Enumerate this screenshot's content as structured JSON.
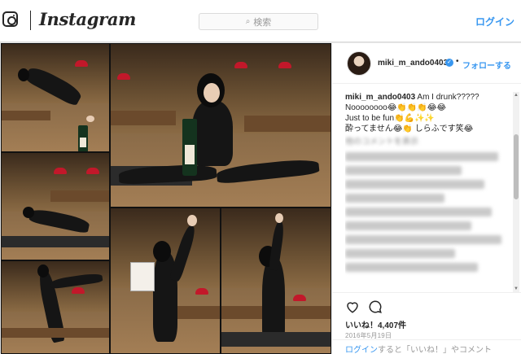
{
  "header": {
    "wordmark": "Instagram",
    "search_placeholder": "検索",
    "login_label": "ログイン"
  },
  "post": {
    "owner": "miki_m_ando0403",
    "verified_glyph": "✓",
    "separator": "•",
    "follow_label": "フォローする",
    "caption_user": "miki_m_ando0403",
    "caption_lines": [
      "Am I drunk?????",
      "Noooooooo😂👏👏👏😂😂",
      "Just to be fun👏💪✨✨",
      "酔ってません😂👏 しらふです笑😂"
    ],
    "blurred_comment_header": "他のコメントを表示",
    "likes": "いいね！4,407件",
    "date": "2016年5月19日",
    "login_prompt_link": "ログイン",
    "login_prompt_rest": "すると「いいね！」やコメント",
    "scroll_up_glyph": "▲",
    "scroll_down_glyph": "▼"
  },
  "colors": {
    "accent": "#3897f0",
    "text": "#262626",
    "muted": "#999999",
    "border": "#dbdbdb"
  },
  "icons": {
    "logo": "instagram-camera-icon",
    "search": "search-icon",
    "verified": "verified-badge-icon",
    "like": "heart-icon",
    "comment": "comment-icon"
  }
}
